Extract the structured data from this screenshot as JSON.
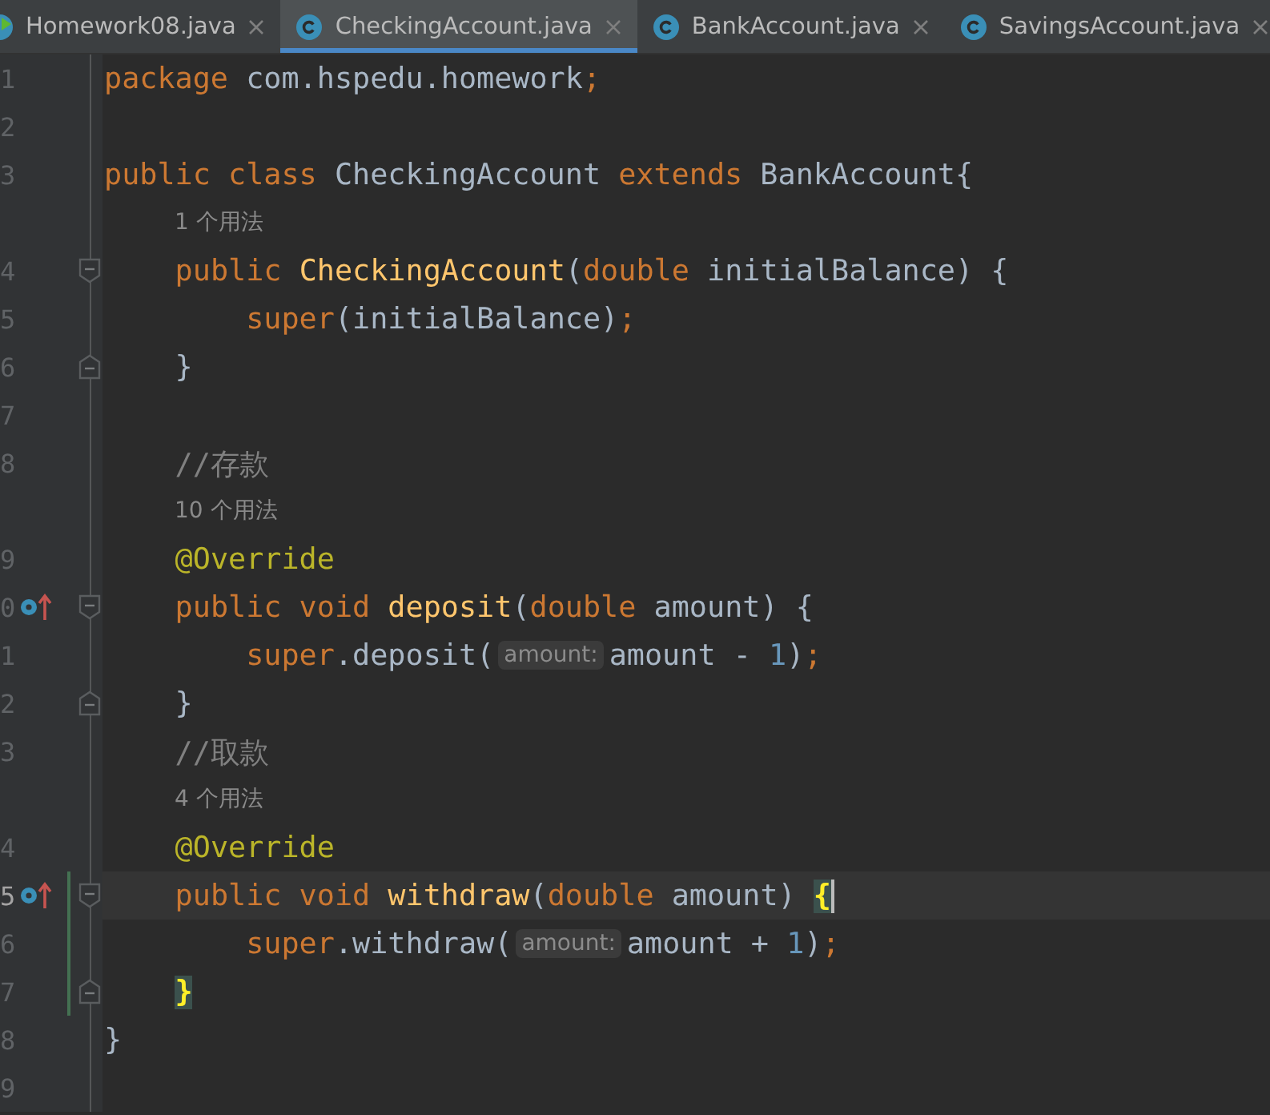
{
  "tabs": [
    {
      "label": "Homework08.java",
      "selected": false,
      "kind": "run"
    },
    {
      "label": "CheckingAccount.java",
      "selected": true,
      "kind": "class"
    },
    {
      "label": "BankAccount.java",
      "selected": false,
      "kind": "class"
    },
    {
      "label": "SavingsAccount.java",
      "selected": false,
      "kind": "class"
    }
  ],
  "lines": [
    {
      "kind": "code",
      "number": "1",
      "tokens": [
        {
          "kind": "keyword",
          "text": "package "
        },
        {
          "kind": "plain",
          "text": "com.hspedu.homework"
        },
        {
          "kind": "keyword",
          "text": ";"
        }
      ]
    },
    {
      "kind": "code",
      "number": "2"
    },
    {
      "kind": "code",
      "number": "3",
      "tokens": [
        {
          "kind": "keyword",
          "text": "public class "
        },
        {
          "kind": "plain",
          "text": "CheckingAccount "
        },
        {
          "kind": "keyword",
          "text": "extends "
        },
        {
          "kind": "plain",
          "text": "BankAccount{"
        }
      ]
    },
    {
      "kind": "usage",
      "text": "1 个用法"
    },
    {
      "kind": "code",
      "number": "4",
      "fold_open": true,
      "tokens": [
        {
          "kind": "keyword",
          "text": "    public "
        },
        {
          "kind": "method",
          "text": "CheckingAccount"
        },
        {
          "kind": "plain",
          "text": "("
        },
        {
          "kind": "keyword",
          "text": "double "
        },
        {
          "kind": "plain",
          "text": "initialBalance) {"
        }
      ]
    },
    {
      "kind": "code",
      "number": "5",
      "tokens": [
        {
          "kind": "keyword",
          "text": "        super"
        },
        {
          "kind": "plain",
          "text": "(initialBalance)"
        },
        {
          "kind": "keyword",
          "text": ";"
        }
      ]
    },
    {
      "kind": "code",
      "number": "6",
      "fold_close": true,
      "tokens": [
        {
          "kind": "plain",
          "text": "    }"
        }
      ]
    },
    {
      "kind": "code",
      "number": "7"
    },
    {
      "kind": "code",
      "number": "8",
      "tokens": [
        {
          "kind": "comment",
          "text": "    //存款"
        }
      ]
    },
    {
      "kind": "usage",
      "text": "10 个用法"
    },
    {
      "kind": "code",
      "number": "9",
      "tokens": [
        {
          "kind": "annotation",
          "text": "    @Override"
        }
      ]
    },
    {
      "kind": "code",
      "number": "0",
      "fold_open": true,
      "overrides": true,
      "tokens": [
        {
          "kind": "keyword",
          "text": "    public void "
        },
        {
          "kind": "method",
          "text": "deposit"
        },
        {
          "kind": "plain",
          "text": "("
        },
        {
          "kind": "keyword",
          "text": "double "
        },
        {
          "kind": "plain",
          "text": "amount) {"
        }
      ]
    },
    {
      "kind": "code",
      "number": "1",
      "tokens": [
        {
          "kind": "keyword",
          "text": "        super"
        },
        {
          "kind": "plain",
          "text": ".deposit("
        },
        {
          "kind": "hint",
          "text": "amount:"
        },
        {
          "kind": "plain",
          "text": "amount - "
        },
        {
          "kind": "number",
          "text": "1"
        },
        {
          "kind": "plain",
          "text": ")"
        },
        {
          "kind": "keyword",
          "text": ";"
        }
      ]
    },
    {
      "kind": "code",
      "number": "2",
      "fold_close": true,
      "tokens": [
        {
          "kind": "plain",
          "text": "    }"
        }
      ]
    },
    {
      "kind": "code",
      "number": "3",
      "tokens": [
        {
          "kind": "comment",
          "text": "    //取款"
        }
      ]
    },
    {
      "kind": "usage",
      "text": "4 个用法"
    },
    {
      "kind": "code",
      "number": "4",
      "tokens": [
        {
          "kind": "annotation",
          "text": "    @Override"
        }
      ]
    },
    {
      "kind": "code",
      "number": "5",
      "fold_open": true,
      "overrides": true,
      "current": true,
      "changed": true,
      "tokens": [
        {
          "kind": "keyword",
          "text": "    public void "
        },
        {
          "kind": "method",
          "text": "withdraw"
        },
        {
          "kind": "plain",
          "text": "("
        },
        {
          "kind": "keyword",
          "text": "double "
        },
        {
          "kind": "plain",
          "text": "amount) "
        },
        {
          "kind": "brace",
          "text": "{",
          "matched": true,
          "caret": true
        }
      ]
    },
    {
      "kind": "code",
      "number": "6",
      "changed": true,
      "tokens": [
        {
          "kind": "keyword",
          "text": "        super"
        },
        {
          "kind": "plain",
          "text": ".withdraw("
        },
        {
          "kind": "hint",
          "text": "amount:"
        },
        {
          "kind": "plain",
          "text": "amount + "
        },
        {
          "kind": "number",
          "text": "1"
        },
        {
          "kind": "plain",
          "text": ")"
        },
        {
          "kind": "keyword",
          "text": ";"
        }
      ]
    },
    {
      "kind": "code",
      "number": "7",
      "fold_close": true,
      "changed": true,
      "tokens": [
        {
          "kind": "brace",
          "text": "    }",
          "matched": true
        }
      ]
    },
    {
      "kind": "code",
      "number": "8",
      "tokens": [
        {
          "kind": "plain",
          "text": "}"
        }
      ]
    },
    {
      "kind": "code",
      "number": "9"
    }
  ]
}
